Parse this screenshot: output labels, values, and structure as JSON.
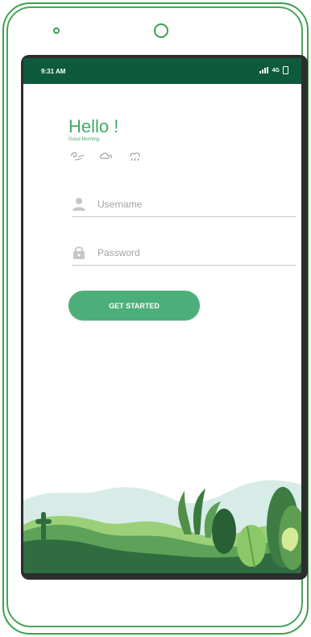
{
  "status_bar": {
    "time": "9:31 AM",
    "network": "4G"
  },
  "header": {
    "title": "Hello !",
    "subtitle": "Good Morning"
  },
  "form": {
    "username_placeholder": "Username",
    "password_placeholder": "Password"
  },
  "actions": {
    "primary_label": "GET STARTED"
  },
  "icons": {
    "weather": [
      "weather-wind-icon",
      "weather-cloud-icon",
      "weather-rain-icon"
    ],
    "user": "user-icon",
    "lock": "lock-icon"
  },
  "colors": {
    "phone_outline": "#3aa24a",
    "status_bar": "#0e5a3c",
    "accent": "#45a868",
    "button": "#4caf79",
    "field_text": "#a3a3a3"
  }
}
